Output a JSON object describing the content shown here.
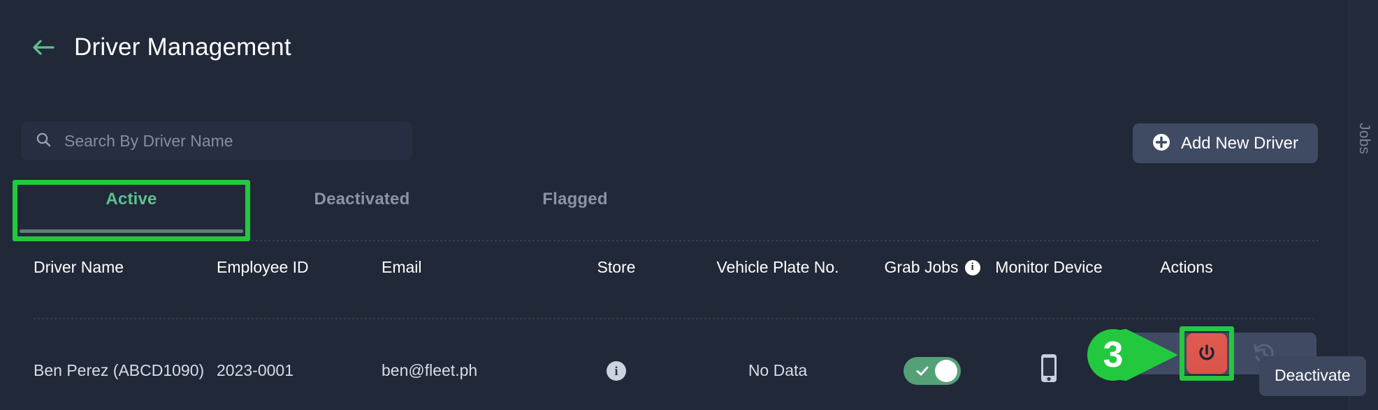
{
  "header": {
    "title": "Driver Management",
    "back_icon": "arrow-left-icon",
    "accent_green": "#5ec08f"
  },
  "search": {
    "placeholder": "Search By Driver Name",
    "value": "",
    "icon": "search-icon"
  },
  "add_button": {
    "label": "Add New Driver",
    "icon": "plus-circle-icon"
  },
  "right_rail": {
    "label": "Jobs"
  },
  "tabs": [
    {
      "label": "Active",
      "selected": true
    },
    {
      "label": "Deactivated",
      "selected": false
    },
    {
      "label": "Flagged",
      "selected": false
    }
  ],
  "table": {
    "columns": [
      "Driver Name",
      "Employee ID",
      "Email",
      "Store",
      "Vehicle Plate No.",
      "Grab Jobs",
      "Monitor Device",
      "Actions"
    ],
    "grab_jobs_info_icon": "info-icon",
    "rows": [
      {
        "driver_name": "Ben Perez (ABCD1090)",
        "employee_id": "2023-0001",
        "email": "ben@fleet.ph",
        "store_icon": "info-icon",
        "vehicle_plate": "No Data",
        "grab_jobs_enabled": true,
        "monitor_device_icon": "mobile-phone-icon",
        "actions": {
          "deactivate_icon": "power-icon",
          "history_icon": "history-restore-icon"
        }
      }
    ]
  },
  "tooltip": {
    "text": "Deactivate"
  },
  "annotations": {
    "step_number": "3",
    "highlight_color": "#22c93f"
  }
}
